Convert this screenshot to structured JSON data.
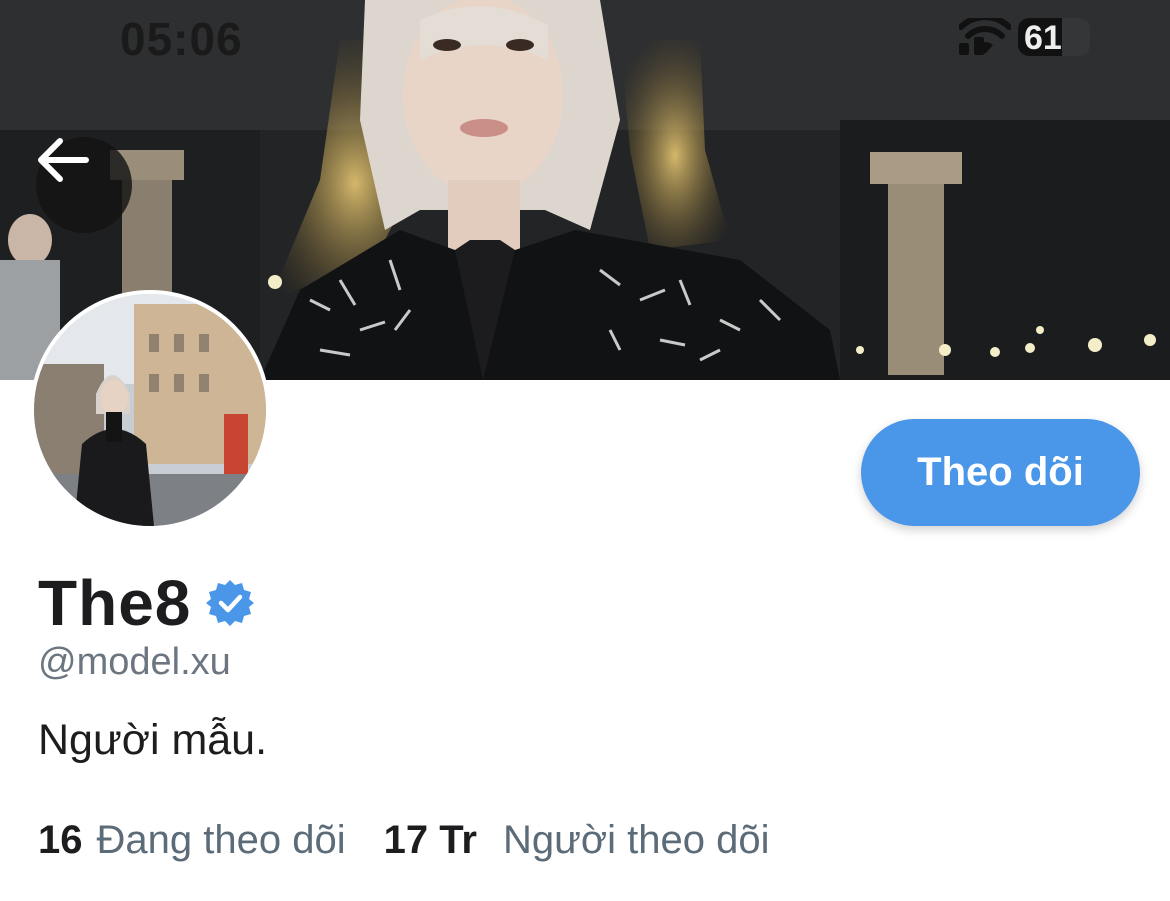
{
  "status_bar": {
    "time": "05:06",
    "battery_level": "61",
    "battery_fraction": 0.61
  },
  "profile": {
    "display_name": "The8",
    "verified": true,
    "handle": "@model.xu",
    "bio": "Người mẫu.",
    "follow_label": "Theo dõi",
    "following_count": "16",
    "following_label": "Đang theo dõi",
    "followers_count": "17 Tr",
    "followers_label": "Người theo dõi"
  },
  "colors": {
    "accent": "#4a96e9",
    "verified_badge": "#4a96e9",
    "secondary_text": "#6b7680",
    "primary_text": "#1d1d1f"
  },
  "icons": {
    "back": "arrow-left-icon",
    "verified": "verified-badge-icon",
    "wifi": "wifi-icon",
    "signal": "cellular-signal-icon",
    "battery": "battery-icon"
  }
}
